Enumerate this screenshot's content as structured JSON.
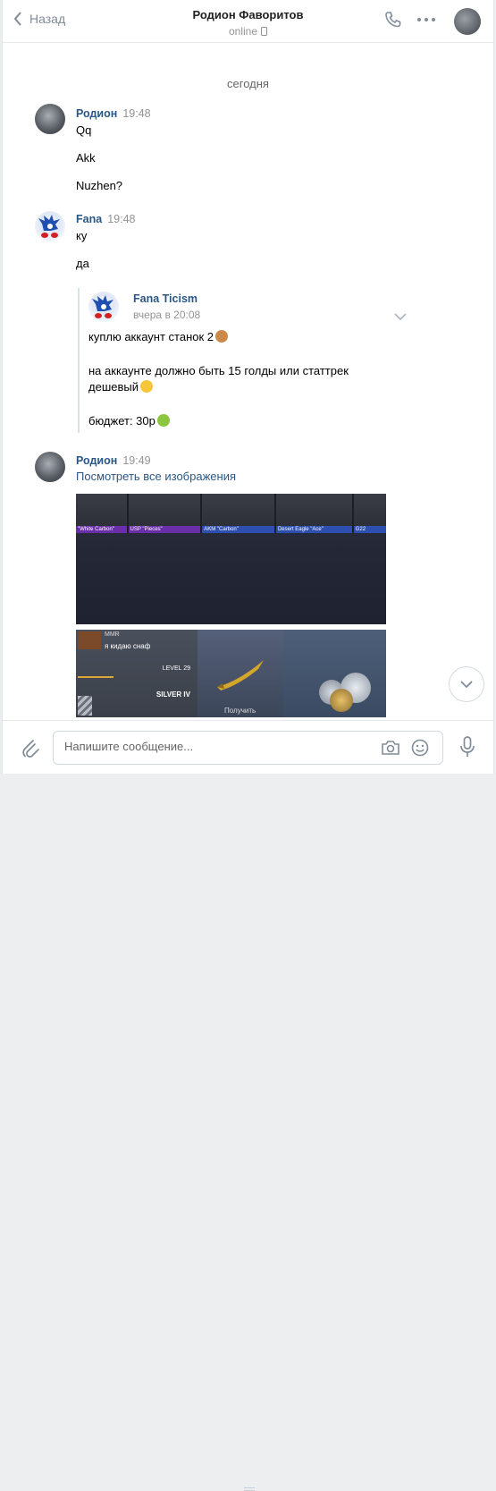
{
  "header": {
    "back_label": "Назад",
    "title": "Родион Фаворитов",
    "status": "online"
  },
  "date_divider": "сегодня",
  "messages": [
    {
      "author": "Родион",
      "time": "19:48",
      "lines": [
        "Qq",
        "Akk",
        "Nuzhen?"
      ]
    },
    {
      "author": "Fana",
      "time": "19:48",
      "lines": [
        "ку",
        "да"
      ]
    },
    {
      "author": "Родион",
      "time": "19:49",
      "link": "Посмотреть все изображения"
    }
  ],
  "forwarded": {
    "author": "Fana Ticism",
    "date": "вчера в 20:08",
    "line1": "куплю аккаунт станок 2",
    "line2a": "на аккаунте должно быть 15 голды или статтрек",
    "line2b": "дешевый",
    "line3": "бюджет: 30р"
  },
  "image1": {
    "labels": [
      "\"White Carbon\"",
      "USP \"Pieces\"",
      "AKМ \"Carbon\"",
      "Desert Eagle \"Ace\"",
      "G22"
    ]
  },
  "image2": {
    "rank": "MMR",
    "line": "я кидаю снаф",
    "level": "LEVEL 29",
    "silver": "SILVER IV",
    "get": "Получить"
  },
  "composer": {
    "placeholder": "Напишите сообщение..."
  },
  "colors": {
    "link": "#2a5885",
    "muted": "#939393"
  }
}
